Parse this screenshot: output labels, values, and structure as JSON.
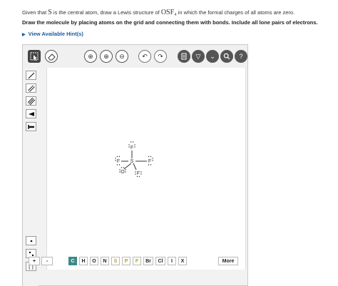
{
  "question": {
    "prefix": "Given that ",
    "central_atom": "S",
    "middle": " is the central atom, draw a Lewis structure of ",
    "formula": "OSF₄",
    "suffix": " in which the formal charges of all atoms are zero."
  },
  "instruction": "Draw the molecule by placing atoms on the grid and connecting them with bonds. Include all lone pairs of electrons.",
  "hint_link": "View Available Hint(s)",
  "toolbar": {
    "zoom_in_icon": "⊕",
    "zoom_reset_icon": "⊕",
    "zoom_out_icon": "⊖",
    "undo_icon": "↶",
    "redo_icon": "↷",
    "help_label": "?"
  },
  "molecule": {
    "atoms": [
      "F",
      "F",
      "F",
      "F",
      "O",
      "S"
    ]
  },
  "bottombar": {
    "plus": "+",
    "minus": "-",
    "elements": [
      "C",
      "H",
      "O",
      "N",
      "S",
      "P",
      "F",
      "Br",
      "Cl",
      "I",
      "X"
    ],
    "more": "More"
  },
  "colors": {
    "hint": "#1a5aa0",
    "carbon_button": "#3a8a8a",
    "element_sp": "#b7a31a"
  }
}
